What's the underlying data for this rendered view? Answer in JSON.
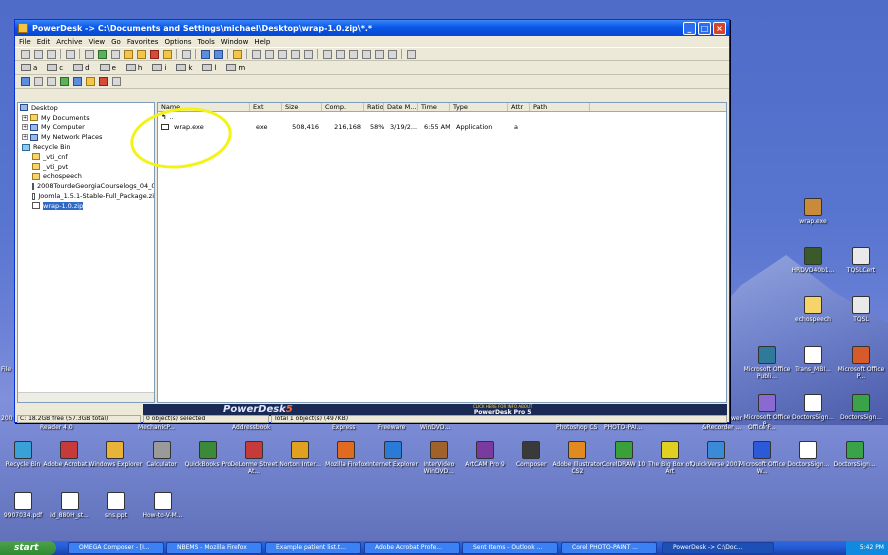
{
  "window": {
    "title": "PowerDesk -> C:\\Documents and Settings\\michael\\Desktop\\wrap-1.0.zip\\*.*",
    "menu": [
      "File",
      "Edit",
      "Archive",
      "View",
      "Go",
      "Favorites",
      "Options",
      "Tools",
      "Window",
      "Help"
    ],
    "drives": [
      "a",
      "c",
      "d",
      "e",
      "h",
      "i",
      "k",
      "l",
      "m"
    ]
  },
  "tree": {
    "items": [
      {
        "label": "Desktop",
        "icon": "desktop-icon"
      },
      {
        "label": "My Documents",
        "icon": "folder-icon"
      },
      {
        "label": "My Computer",
        "icon": "computer-icon"
      },
      {
        "label": "My Network Places",
        "icon": "network-icon"
      },
      {
        "label": "Recycle Bin",
        "icon": "recycle-bin-icon"
      },
      {
        "label": "_vti_cnf",
        "icon": "folder-icon"
      },
      {
        "label": "_vti_pvt",
        "icon": "folder-icon"
      },
      {
        "label": "echospeech",
        "icon": "folder-icon"
      },
      {
        "label": "2008TourdeGeorgiaCourselogs_04_0",
        "icon": "zip-icon"
      },
      {
        "label": "Joomla_1.5.1-Stable-Full_Package.zi",
        "icon": "zip-icon"
      },
      {
        "label": "wrap-1.0.zip",
        "icon": "zip-icon"
      }
    ]
  },
  "list": {
    "columns": [
      "Name",
      "Ext",
      "Size",
      "Comp.",
      "Ratio",
      "Date M...",
      "Time",
      "Type",
      "Attr",
      "Path"
    ],
    "up_label": "..",
    "rows": [
      {
        "name": "wrap.exe",
        "ext": "exe",
        "size": "508,416",
        "comp": "216,168",
        "ratio": "58%",
        "date": "3/19/2...",
        "time": "6:55 AM",
        "type": "Application",
        "attr": "a",
        "path": ""
      }
    ]
  },
  "status": {
    "free": "C: 18.2GB free (57.3GB total)",
    "selected": "0 object(s) selected",
    "total": "Total 1 object(s) (497KB)",
    "logo": "PowerDesk",
    "logo_version": "5",
    "ad_small": "CLICK HERE FOR INFO ABOUT",
    "ad_big": "PowerDesk Pro 5"
  },
  "desktop_icons_right": [
    {
      "label": "wrap.exe",
      "icon": "zip-icon"
    },
    {
      "label": "HRDVD40b1...",
      "icon": "app-icon"
    },
    {
      "label": "TQSLCert",
      "icon": "app-icon"
    },
    {
      "label": "echospeech",
      "icon": "folder-icon"
    },
    {
      "label": "TQSL",
      "icon": "app-icon"
    },
    {
      "label": "Microsoft Office Publi...",
      "icon": "app-icon"
    },
    {
      "label": "Trans_MBI...",
      "icon": "pdf-icon"
    },
    {
      "label": "Microsoft Office P...",
      "icon": "app-icon"
    },
    {
      "label": "Microsoft Office P...",
      "icon": "app-icon"
    },
    {
      "label": "DoctorsSign...",
      "icon": "pdf-icon"
    },
    {
      "label": "DoctorsSign...",
      "icon": "app-icon"
    }
  ],
  "desktop_row1_labels": [
    "Reader 4.0",
    "MechanicP...",
    "Addressbook",
    "Express",
    "Freeware",
    "WinDVD...",
    "Photoshop CS",
    "PHOTO-PAI...",
    "&Recorder ...",
    "Office F..."
  ],
  "desktop_row2": [
    "Recycle Bin",
    "Adobe Acrobat ...",
    "Windows Explorer",
    "Calculator",
    "QuickBooks Pro",
    "DeLorme Street At...",
    "Norton Inter...",
    "Mozilla Firefox",
    "Internet Explorer",
    "InterVideo WinDVD...",
    "ArtCAM Pro 9",
    "Composer",
    "Adobe Illustrator CS2",
    "CorelDRAW 10",
    "The Big Box of Art",
    "QuickVerse 2007",
    "Microsoft Office W...",
    "DoctorsSign...",
    "DoctorsSign..."
  ],
  "desktop_row3": [
    "9907034.pdf",
    "id_880H_st...",
    "sns.ppt",
    "How-to-V-M..."
  ],
  "edge_labels": {
    "left_file": "File",
    "left_200": "200",
    "wer": "wer"
  },
  "taskbar": {
    "start": "start",
    "tasks": [
      "OMEGA Composer - [I...",
      "NBEMS - Mozilla Firefox",
      "Example patient list.t...",
      "Adobe Acrobat Profe...",
      "Sent Items - Outlook ...",
      "Corel PHOTO-PAINT ...",
      "PowerDesk -> C:\\Doc..."
    ],
    "clock": "5:42 PM"
  },
  "colors": {
    "highlight_circle": "#f3f316",
    "title_bar": "#0a58e8",
    "taskbar": "#245edb"
  }
}
